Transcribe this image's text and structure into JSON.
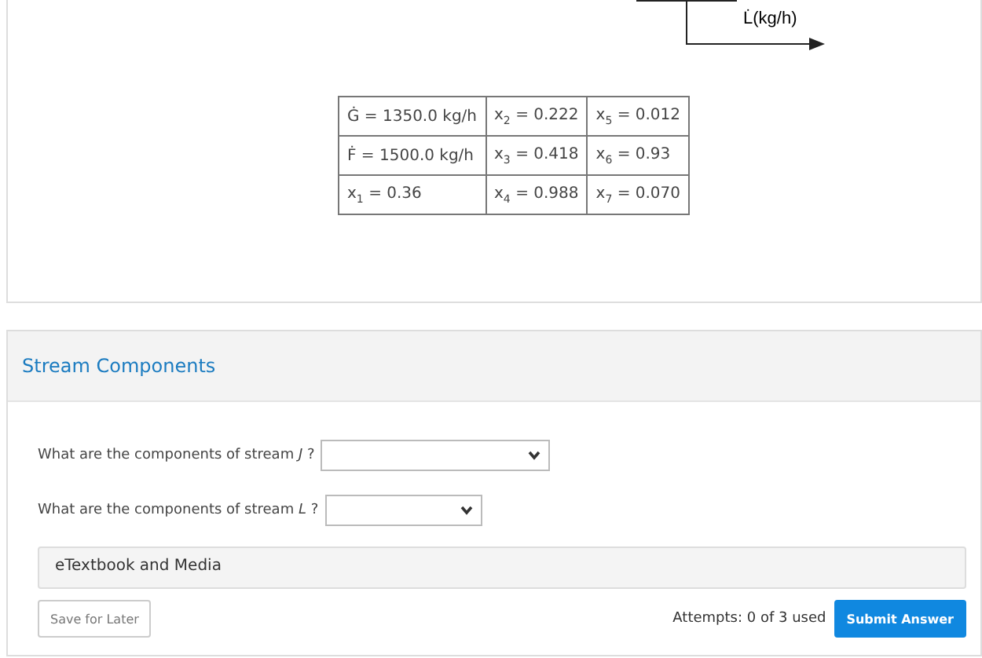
{
  "diagram": {
    "stream_label": "L̇(kg/h)"
  },
  "table": {
    "rows": [
      [
        "Ġ = 1350.0 kg/h",
        "x$_{2}$ = 0.222",
        "x$_{5}$ = 0.012"
      ],
      [
        "Ḟ = 1500.0 kg/h",
        "x$_{3}$ = 0.418",
        "x$_{6}$ = 0.93"
      ],
      [
        "x$_{1}$ = 0.36",
        "x$_{4}$ = 0.988",
        "x$_{7}$ = 0.070"
      ]
    ]
  },
  "section": {
    "title": "Stream Components",
    "questions": [
      {
        "label": "What are the components of stream *J* ?",
        "kind": "wide"
      },
      {
        "label": "What are the components of stream *L* ?",
        "kind": "narrow"
      }
    ],
    "media": "eTextbook and Media",
    "save_button": "Save for Later",
    "attempts": "Attempts: 0 of 3 used",
    "submit_button": "Submit Answer"
  }
}
